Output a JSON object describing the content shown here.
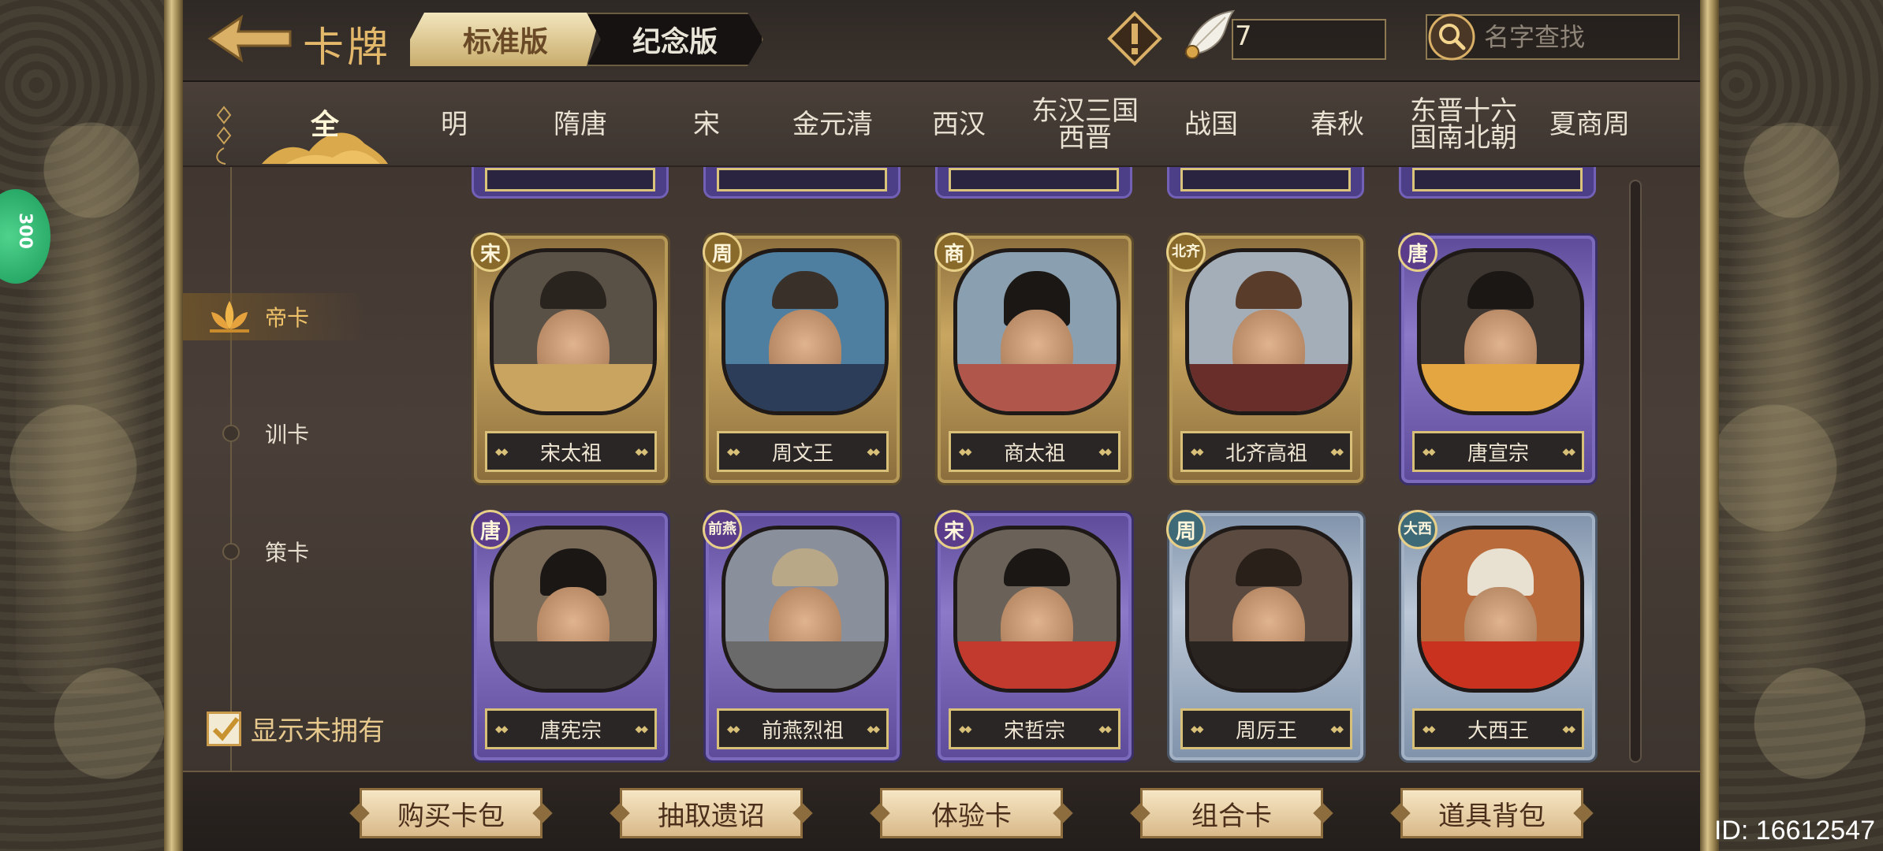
{
  "header": {
    "title": "卡牌",
    "edition_tabs": [
      {
        "label": "标准版",
        "active": true
      },
      {
        "label": "纪念版",
        "active": false
      }
    ],
    "currency_value": "7",
    "search_placeholder": "名字查找"
  },
  "side_badge": "300",
  "dynasty_tabs": [
    {
      "label": "全",
      "active": true
    },
    {
      "label": "明"
    },
    {
      "label": "隋唐"
    },
    {
      "label": "宋"
    },
    {
      "label": "金元清"
    },
    {
      "label": "西汉"
    },
    {
      "label": "东汉三国\n西晋"
    },
    {
      "label": "战国"
    },
    {
      "label": "春秋"
    },
    {
      "label": "东晋十六\n国南北朝"
    },
    {
      "label": "夏商周"
    }
  ],
  "categories": [
    {
      "label": "帝卡",
      "active": true
    },
    {
      "label": "训卡"
    },
    {
      "label": "策卡"
    }
  ],
  "show_unowned": {
    "label": "显示未拥有",
    "checked": true
  },
  "cards": [
    {
      "name": "宋太祖",
      "badge": "宋",
      "tier": "gold"
    },
    {
      "name": "周文王",
      "badge": "周",
      "tier": "gold"
    },
    {
      "name": "商太祖",
      "badge": "商",
      "tier": "gold"
    },
    {
      "name": "北齐高祖",
      "badge": "北齐",
      "tier": "gold"
    },
    {
      "name": "唐宣宗",
      "badge": "唐",
      "tier": "purple"
    },
    {
      "name": "唐宪宗",
      "badge": "唐",
      "tier": "purple"
    },
    {
      "name": "前燕烈祖",
      "badge": "前燕",
      "tier": "purple"
    },
    {
      "name": "宋哲宗",
      "badge": "宋",
      "tier": "purple"
    },
    {
      "name": "周厉王",
      "badge": "周",
      "tier": "silver"
    },
    {
      "name": "大西王",
      "badge": "大西",
      "tier": "silver"
    }
  ],
  "actions": [
    "购买卡包",
    "抽取遗诏",
    "体验卡",
    "组合卡",
    "道具背包"
  ],
  "player_id": "ID: 16612547",
  "colors": {
    "accent_gold": "#e3b86a",
    "tier_gold": "#c9a660",
    "tier_purple": "#8c7ac8",
    "tier_silver": "#bcc8d6"
  },
  "icons": {
    "back": "back-arrow-icon",
    "warning": "exclamation-icon",
    "currency": "feather-crest-icon",
    "search": "search-icon",
    "category_active": "lotus-icon",
    "checkbox": "check-icon"
  }
}
